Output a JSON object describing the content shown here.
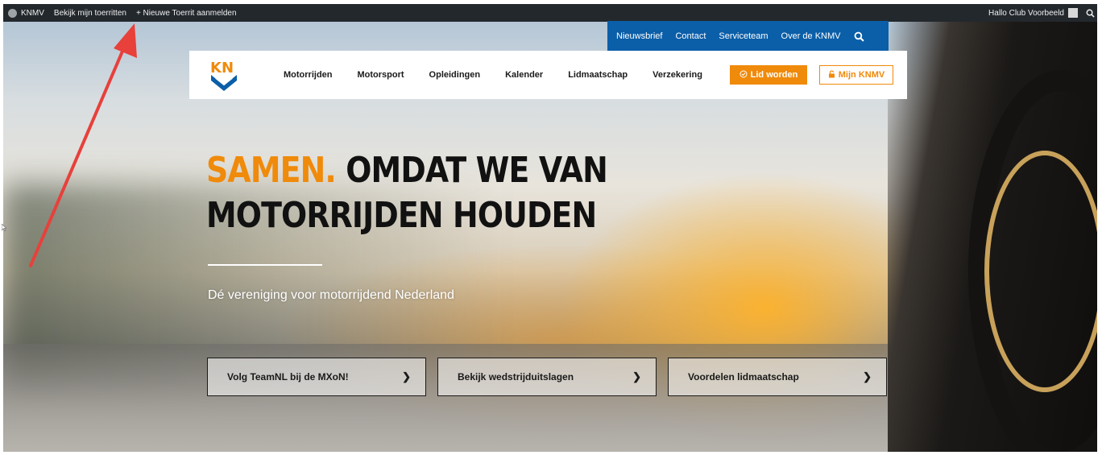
{
  "admin_bar": {
    "site_name": "KNMV",
    "my_rides": "Bekijk mijn toerritten",
    "new_ride": "+ Nieuwe Toerrit aanmelden",
    "greeting": "Hallo Club Voorbeeld"
  },
  "top_nav": [
    "Nieuwsbrief",
    "Contact",
    "Serviceteam",
    "Over de KNMV"
  ],
  "main_nav": [
    "Motorrijden",
    "Motorsport",
    "Opleidingen",
    "Kalender",
    "Lidmaatschap",
    "Verzekering"
  ],
  "buttons": {
    "join": "Lid worden",
    "account": "Mijn KNMV"
  },
  "logo_text": "KN",
  "hero": {
    "headline_orange": "SAMEN.",
    "headline_rest_line1": " OMDAT WE VAN",
    "headline_line2": "MOTORRIJDEN HOUDEN",
    "tagline": "Dé vereniging voor motorrijdend Nederland"
  },
  "cta": [
    "Volg TeamNL bij de MXoN!",
    "Bekijk wedstrijduitslagen",
    "Voordelen lidmaatschap"
  ],
  "colors": {
    "brand_orange": "#f08a0a",
    "brand_blue": "#0b5ea8",
    "admin_bar": "#23282d",
    "annotation_arrow": "#e8403b"
  },
  "icons": [
    "search-icon",
    "chevron-right-icon",
    "check-circle-icon",
    "lock-icon",
    "wordpress-icon",
    "avatar"
  ]
}
